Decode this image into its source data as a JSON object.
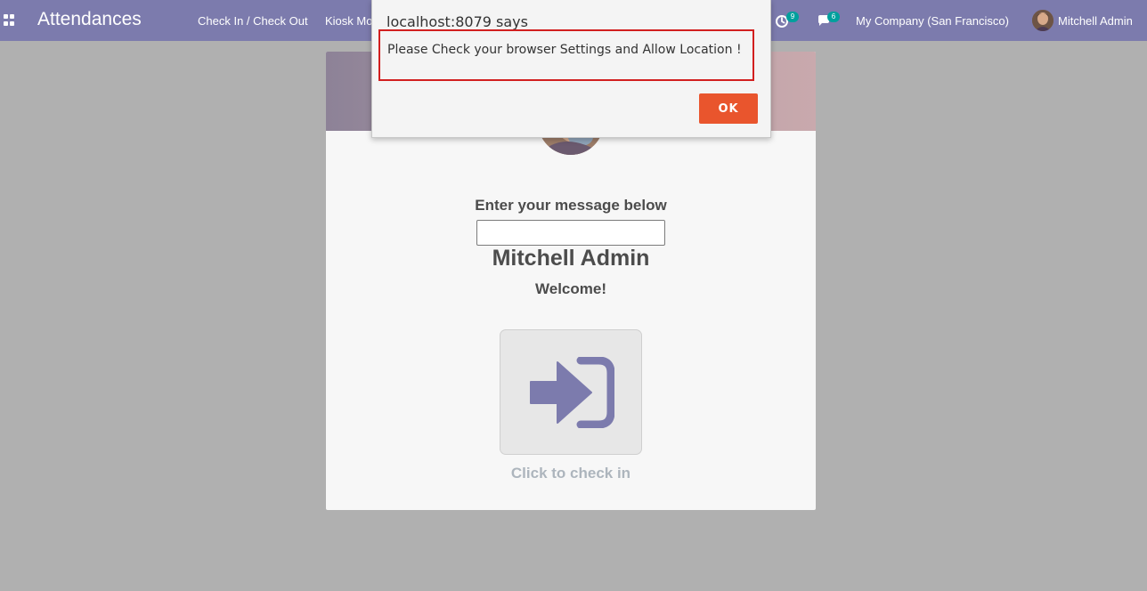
{
  "navbar": {
    "app_title": "Attendances",
    "menu_items": [
      {
        "label": "Check In / Check Out"
      },
      {
        "label": "Kiosk Mo"
      }
    ],
    "activity_count": "9",
    "message_count": "6",
    "company": "My Company (San Francisco)",
    "user": "Mitchell Admin",
    "background_color": "#7c7bad"
  },
  "attendance_card": {
    "prompt": "Enter your message below",
    "message_input_value": "",
    "employee_name": "Mitchell Admin",
    "greeting": "Welcome!",
    "checkin_hint": "Click to check in",
    "checkin_icon": "sign-in-icon",
    "icon_color": "#7c7bad"
  },
  "alert": {
    "title": "localhost:8079 says",
    "message": "Please Check your browser Settings and Allow Location !",
    "ok_label": "OK",
    "ok_color": "#e9552d",
    "highlight_color": "#d21f1f"
  }
}
